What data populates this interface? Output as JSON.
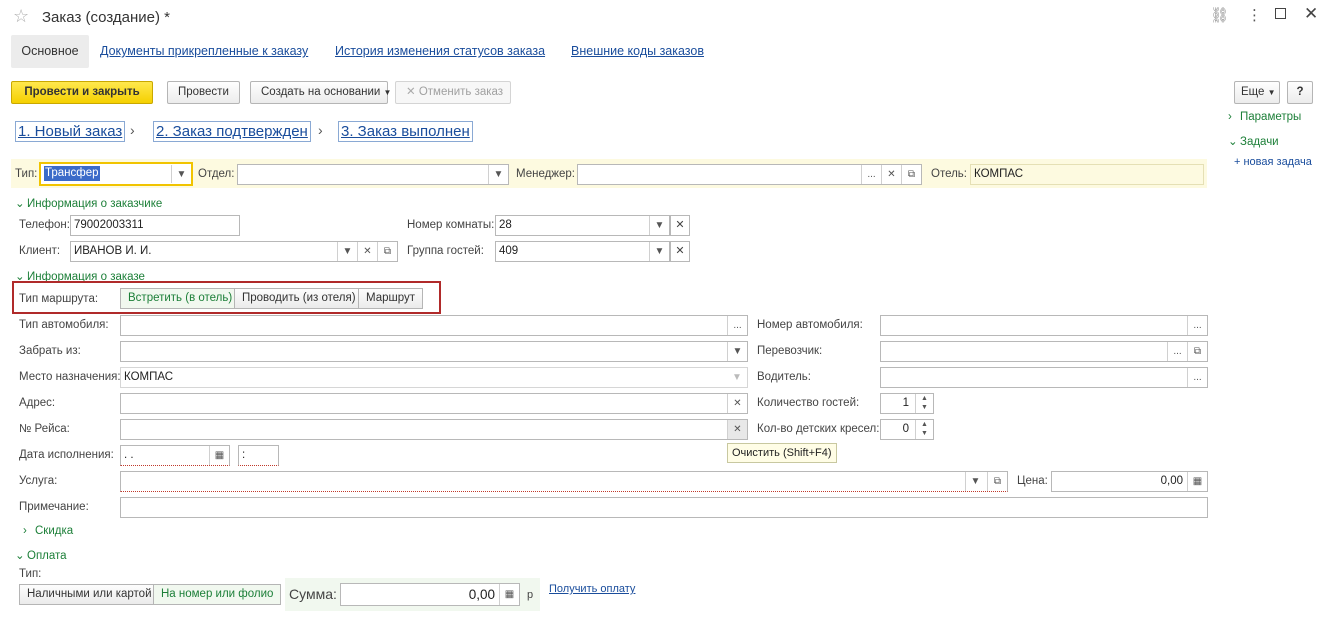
{
  "window": {
    "title": "Заказ (создание) *",
    "tabs": [
      "Основное",
      "Документы прикрепленные к заказу",
      "История изменения статусов заказа",
      "Внешние коды заказов"
    ]
  },
  "toolbar": {
    "post_close": "Провести и закрыть",
    "post": "Провести",
    "create_based": "Создать на основании",
    "cancel_order": "Отменить заказ",
    "more": "Еще",
    "help": "?"
  },
  "right_panel": {
    "params": "Параметры",
    "tasks": "Задачи",
    "new_task": "+ новая задача"
  },
  "steps": [
    "1. Новый заказ",
    "2. Заказ подтвержден",
    "3. Заказ выполнен"
  ],
  "header_row": {
    "type_label": "Тип:",
    "type_value": "Трансфер",
    "dept_label": "Отдел:",
    "dept_value": "",
    "manager_label": "Менеджер:",
    "manager_value": "",
    "hotel_label": "Отель:",
    "hotel_value": "КОМПАС"
  },
  "customer": {
    "section": "Информация о заказчике",
    "phone_label": "Телефон:",
    "phone_value": "79002003311",
    "client_label": "Клиент:",
    "client_value": "ИВАНОВ И. И.",
    "room_label": "Номер комнаты:",
    "room_value": "28",
    "group_label": "Группа гостей:",
    "group_value": "409"
  },
  "order": {
    "section": "Информация о заказе",
    "route_label": "Тип маршрута:",
    "route_options": [
      "Встретить (в отель)",
      "Проводить (из отеля)",
      "Маршрут"
    ],
    "car_type_label": "Тип автомобиля:",
    "car_type_value": "",
    "pickup_label": "Забрать из:",
    "pickup_value": "",
    "dest_label": "Место назначения:",
    "dest_value": "КОМПАС",
    "address_label": "Адрес:",
    "address_value": "",
    "flight_label": "№ Рейса:",
    "flight_value": "",
    "date_label": "Дата исполнения:",
    "date_value": " .  .",
    "time_value": " :",
    "service_label": "Услуга:",
    "service_value": "",
    "note_label": "Примечание:",
    "note_value": "",
    "car_number_label": "Номер автомобиля:",
    "car_number_value": "",
    "carrier_label": "Перевозчик:",
    "carrier_value": "",
    "driver_label": "Водитель:",
    "driver_value": "",
    "guests_label": "Количество гостей:",
    "guests_value": "1",
    "child_seats_label": "Кол-во детских кресел:",
    "child_seats_value": "0",
    "price_label": "Цена:",
    "price_value": "0,00",
    "tooltip": "Очистить (Shift+F4)"
  },
  "discount": {
    "section": "Скидка"
  },
  "payment": {
    "section": "Оплата",
    "type_label": "Тип:",
    "options": [
      "Наличными или картой",
      "На номер или фолио"
    ],
    "sum_label": "Сумма:",
    "sum_value": "0,00",
    "currency": "р",
    "get_payment": "Получить оплату"
  },
  "colors": {
    "accent_green": "#1c7f38",
    "link_blue": "#1a4d9c",
    "primary_yellow": "#f5d000",
    "highlight_red": "#b02a2a"
  }
}
